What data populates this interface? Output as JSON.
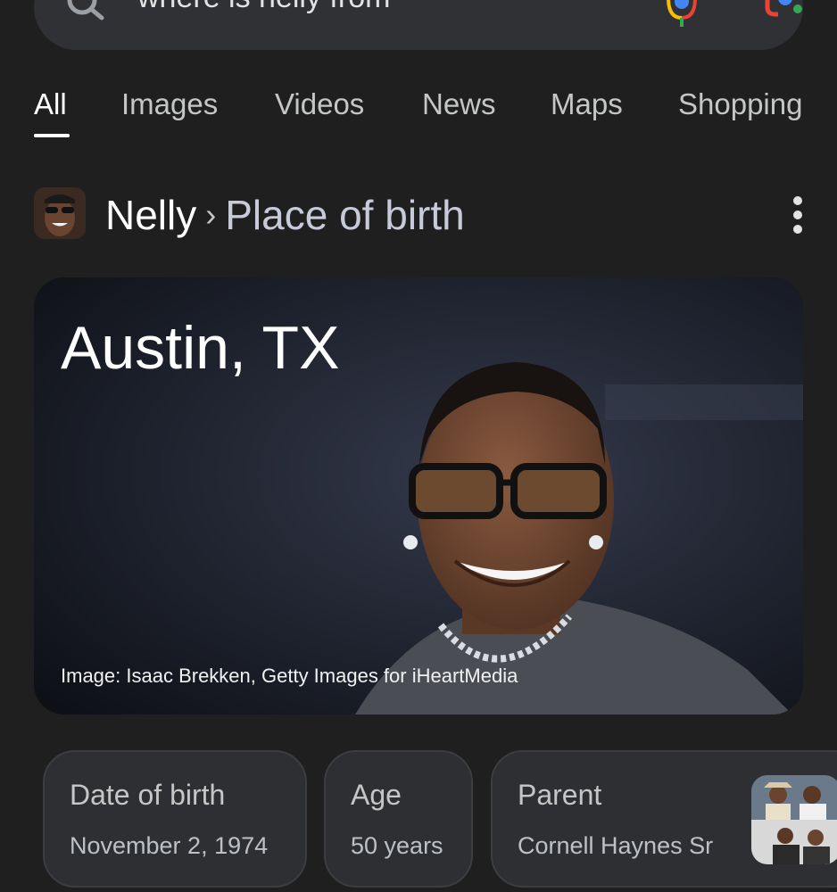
{
  "search": {
    "query": "where is nelly from"
  },
  "icons": {
    "search": "search-icon",
    "mic": "mic-icon",
    "lens": "lens-icon",
    "more": "more-vert-icon"
  },
  "tabs": [
    {
      "label": "All",
      "active": true
    },
    {
      "label": "Images",
      "active": false
    },
    {
      "label": "Videos",
      "active": false
    },
    {
      "label": "News",
      "active": false
    },
    {
      "label": "Maps",
      "active": false
    },
    {
      "label": "Shopping",
      "active": false
    }
  ],
  "entity": {
    "name": "Nelly",
    "separator": "›",
    "attribute": "Place of birth"
  },
  "answer": {
    "value": "Austin, TX",
    "image_credit": "Image: Isaac Brekken, Getty Images for iHeartMedia"
  },
  "facts": [
    {
      "label": "Date of birth",
      "value": "November 2, 1974"
    },
    {
      "label": "Age",
      "value": "50 years"
    },
    {
      "label": "Parent",
      "value": "Cornell Haynes Sr"
    }
  ],
  "colors": {
    "background": "#1f1f1f",
    "surface": "#303134",
    "chip": "#2e2f32",
    "google_blue": "#4285f4",
    "google_red": "#ea4335",
    "google_yellow": "#fbbc04",
    "google_green": "#34a853"
  }
}
